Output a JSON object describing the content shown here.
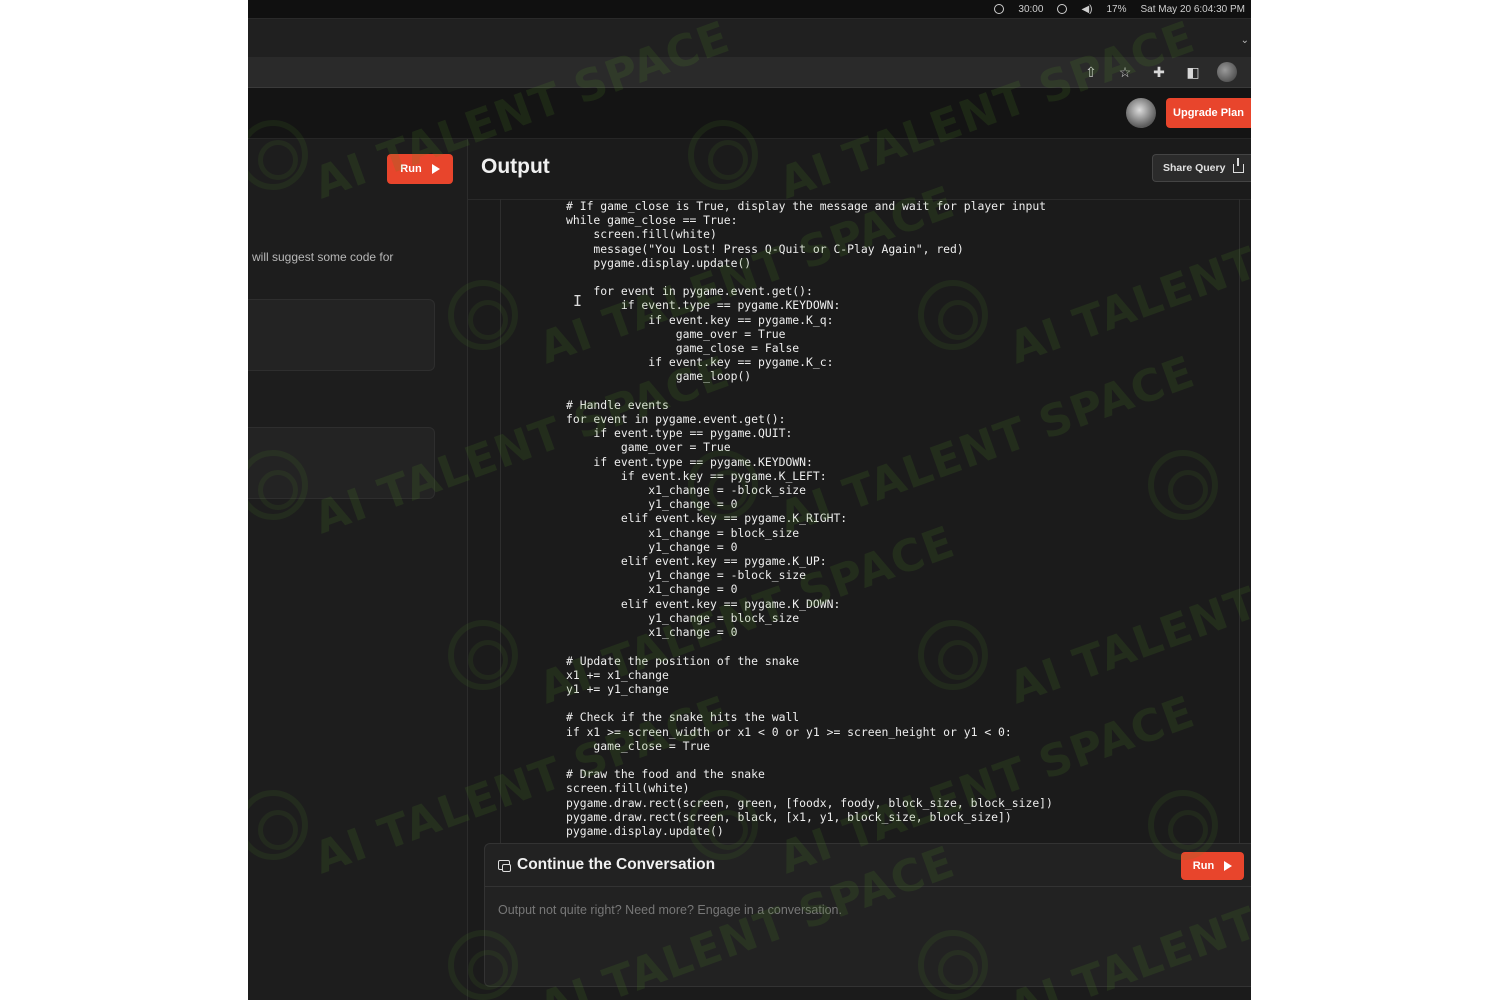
{
  "os_bar": {
    "time_remaining": "30:00",
    "battery": "17%",
    "datetime": "Sat May 20 6:04:30 PM"
  },
  "app_header": {
    "upgrade_label": "Upgrade Plan"
  },
  "left_panel": {
    "run_label": "Run",
    "description": "will suggest some code for"
  },
  "output": {
    "title": "Output",
    "share_label": "Share Query",
    "code": "# If game_close is True, display the message and wait for player input\nwhile game_close == True:\n    screen.fill(white)\n    message(\"You Lost! Press Q-Quit or C-Play Again\", red)\n    pygame.display.update()\n\n    for event in pygame.event.get():\n        if event.type == pygame.KEYDOWN:\n            if event.key == pygame.K_q:\n                game_over = True\n                game_close = False\n            if event.key == pygame.K_c:\n                game_loop()\n\n# Handle events\nfor event in pygame.event.get():\n    if event.type == pygame.QUIT:\n        game_over = True\n    if event.type == pygame.KEYDOWN:\n        if event.key == pygame.K_LEFT:\n            x1_change = -block_size\n            y1_change = 0\n        elif event.key == pygame.K_RIGHT:\n            x1_change = block_size\n            y1_change = 0\n        elif event.key == pygame.K_UP:\n            y1_change = -block_size\n            x1_change = 0\n        elif event.key == pygame.K_DOWN:\n            y1_change = block_size\n            x1_change = 0\n\n# Update the position of the snake\nx1 += x1_change\ny1 += y1_change\n\n# Check if the snake hits the wall\nif x1 >= screen_width or x1 < 0 or y1 >= screen_height or y1 < 0:\n    game_close = True\n\n# Draw the food and the snake\nscreen.fill(white)\npygame.draw.rect(screen, green, [foodx, foody, block_size, block_size])\npygame.draw.rect(screen, black, [x1, y1, block_size, block_size])\npygame.display.update()"
  },
  "conversation": {
    "title": "Continue the Conversation",
    "run_label": "Run",
    "placeholder": "Output not quite right? Need more? Engage in a conversation."
  },
  "watermark": {
    "text": "AI TALENT SPACE"
  },
  "colors": {
    "accent": "#e8452c",
    "background": "#1b1b1b"
  }
}
